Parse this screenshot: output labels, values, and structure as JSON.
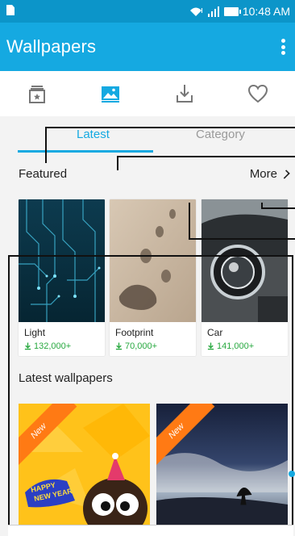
{
  "status": {
    "time": "10:48 AM"
  },
  "app_bar": {
    "title": "Wallpapers"
  },
  "icon_bar": {
    "items": [
      {
        "icon": "local-album-icon",
        "active": false
      },
      {
        "icon": "gallery-icon",
        "active": true
      },
      {
        "icon": "download-icon",
        "active": false
      },
      {
        "icon": "favorite-heart-icon",
        "active": false
      }
    ]
  },
  "tabs": {
    "latest": "Latest",
    "category": "Category"
  },
  "featured": {
    "title": "Featured",
    "more": "More",
    "cards": [
      {
        "name": "Light",
        "count": "132,000+"
      },
      {
        "name": "Footprint",
        "count": "70,000+"
      },
      {
        "name": "Car",
        "count": "141,000+"
      }
    ]
  },
  "latest_wallpapers": {
    "title": "Latest wallpapers",
    "badge": "New",
    "badge2": "New",
    "card1_text_1": "HAPPY",
    "card1_text_2": "NEW YEAR"
  },
  "colors": {
    "accent": "#15a9e1",
    "status": "#0c95c9",
    "download_green": "#28a940",
    "new_badge": "#ff7a14"
  }
}
